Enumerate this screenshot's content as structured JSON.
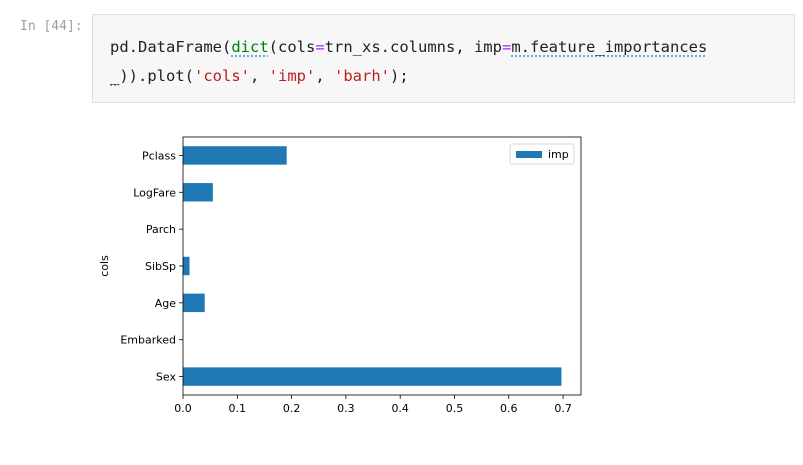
{
  "cell": {
    "prompt": "In [44]:",
    "code": {
      "line1": [
        {
          "t": "pd.DataFrame(",
          "c": ""
        },
        {
          "t": "dict",
          "c": "bi"
        },
        {
          "t": "(cols",
          "c": ""
        },
        {
          "t": "=",
          "c": "op"
        },
        {
          "t": "trn_xs.columns, imp",
          "c": ""
        },
        {
          "t": "=",
          "c": "op"
        },
        {
          "t": "m.feature_importances",
          "c": "sp"
        }
      ],
      "line2": [
        {
          "t": "_",
          "c": "sp"
        },
        {
          "t": ")).plot(",
          "c": ""
        },
        {
          "t": "'cols'",
          "c": "sq"
        },
        {
          "t": ", ",
          "c": ""
        },
        {
          "t": "'imp'",
          "c": "sq"
        },
        {
          "t": ", ",
          "c": ""
        },
        {
          "t": "'barh'",
          "c": "sq"
        },
        {
          "t": ");",
          "c": ""
        }
      ]
    }
  },
  "chart_data": {
    "type": "bar",
    "orientation": "horizontal",
    "categories": [
      "Sex",
      "Embarked",
      "Age",
      "SibSp",
      "Parch",
      "LogFare",
      "Pclass"
    ],
    "series": [
      {
        "name": "imp",
        "values": [
          0.697,
          0.0,
          0.04,
          0.012,
          0.0,
          0.055,
          0.191
        ]
      }
    ],
    "ylabel": "cols",
    "xlabel": "",
    "xlim": [
      0,
      0.733
    ],
    "xticks": [
      "0.0",
      "0.1",
      "0.2",
      "0.3",
      "0.4",
      "0.5",
      "0.6",
      "0.7"
    ],
    "grid": false,
    "legend": "top-right",
    "bar_color": "#1f77b4"
  }
}
